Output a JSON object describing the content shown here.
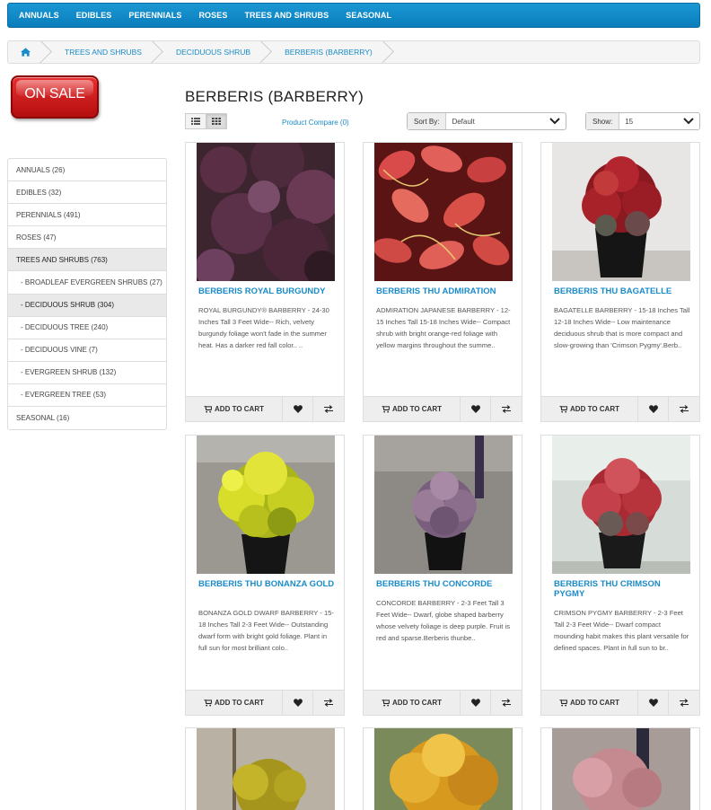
{
  "nav": [
    "ANNUALS",
    "EDIBLES",
    "PERENNIALS",
    "ROSES",
    "TREES AND SHRUBS",
    "SEASONAL"
  ],
  "breadcrumb": [
    "TREES AND SHRUBS",
    "DECIDUOUS SHRUB",
    "BERBERIS (BARBERRY)"
  ],
  "sale_label": "ON SALE",
  "categories": [
    {
      "label": "ANNUALS (26)"
    },
    {
      "label": "EDIBLES (32)"
    },
    {
      "label": "PERENNIALS (491)"
    },
    {
      "label": "ROSES (47)"
    },
    {
      "label": "TREES AND SHRUBS (763)"
    },
    {
      "label": "- BROADLEAF EVERGREEN SHRUBS (27)"
    },
    {
      "label": "- DECIDUOUS SHRUB (304)"
    },
    {
      "label": "- DECIDUOUS TREE (240)"
    },
    {
      "label": "- DECIDUOUS VINE (7)"
    },
    {
      "label": "- EVERGREEN SHRUB (132)"
    },
    {
      "label": "- EVERGREEN TREE (53)"
    },
    {
      "label": "SEASONAL (16)"
    }
  ],
  "page_title": "BERBERIS (BARBERRY)",
  "compare_label": "Product Compare (0)",
  "sort": {
    "label": "Sort By:",
    "value": "Default"
  },
  "show": {
    "label": "Show:",
    "value": "15"
  },
  "add_to_cart_label": "ADD TO CART",
  "products": [
    {
      "name": "BERBERIS ROYAL BURGUNDY",
      "desc": "ROYAL BURGUNDY® BARBERRY - 24-30 Inches Tall 3 Feet Wide-- Rich, velvety burgundy foliage won't fade in the summer heat. Has a darker red fall color.. .."
    },
    {
      "name": "BERBERIS THU ADMIRATION",
      "desc": "ADMIRATION JAPANESE BARBERRY - 12-15 Inches Tall 15-18 Inches Wide-- Compact shrub with bright orange-red foliage with yellow margins throughout the summe.."
    },
    {
      "name": "BERBERIS THU BAGATELLE",
      "desc": "BAGATELLE BARBERRY - 15-18 Inches Tall 12-18 Inches Wide-- Low maintenance deciduous shrub that is more compact and slow-growing than 'Crimson Pygmy'.Berb.."
    },
    {
      "name": "BERBERIS THU BONANZA GOLD",
      "desc": "BONANZA GOLD DWARF BARBERRY - 15-18 Inches Tall 2-3 Feet Wide-- Outstanding dwarf form with bright gold foliage. Plant in full sun for most brilliant colo.."
    },
    {
      "name": "BERBERIS THU CONCORDE",
      "desc": "CONCORDE BARBERRY - 2-3 Feet Tall 3 Feet Wide-- Dwarf, globe shaped barberry whose velvety foliage is deep purple. Fruit is red and sparse.Berberis thunbe.."
    },
    {
      "name": "BERBERIS THU CRIMSON PYGMY",
      "desc": "CRIMSON PYGMY BARBERRY - 2-3 Feet Tall 2-3 Feet Wide-- Dwarf compact mounding habit makes this plant versatile for defined spaces. Plant in full sun to br.."
    }
  ]
}
